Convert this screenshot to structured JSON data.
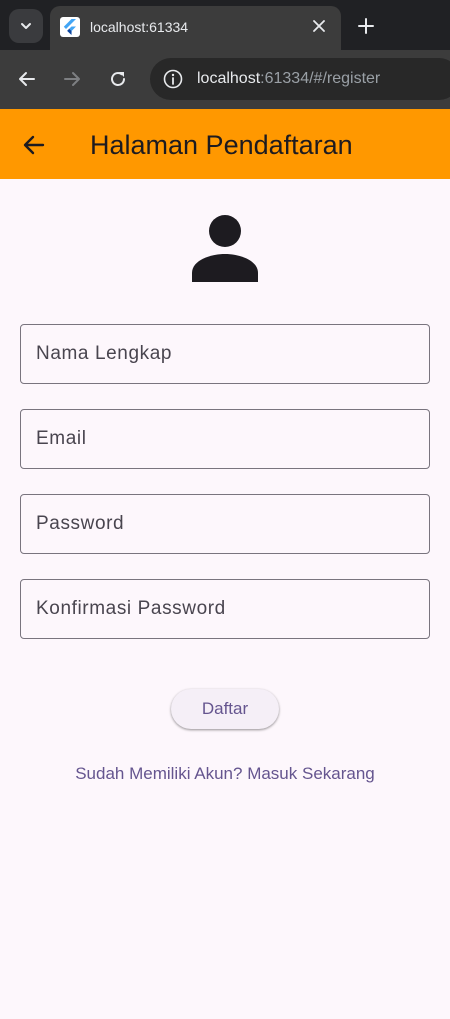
{
  "browser": {
    "tab_title": "localhost:61334",
    "url_host": "localhost",
    "url_path": ":61334/#/register"
  },
  "appbar": {
    "title": "Halaman Pendaftaran"
  },
  "form": {
    "full_name_label": "Nama Lengkap",
    "email_label": "Email",
    "password_label": "Password",
    "confirm_password_label": "Konfirmasi Password",
    "submit_label": "Daftar",
    "login_link_label": "Sudah Memiliki Akun? Masuk Sekarang"
  },
  "colors": {
    "appbar": "#ff9800",
    "background": "#fdf7fc",
    "accent_text": "#65558f"
  }
}
